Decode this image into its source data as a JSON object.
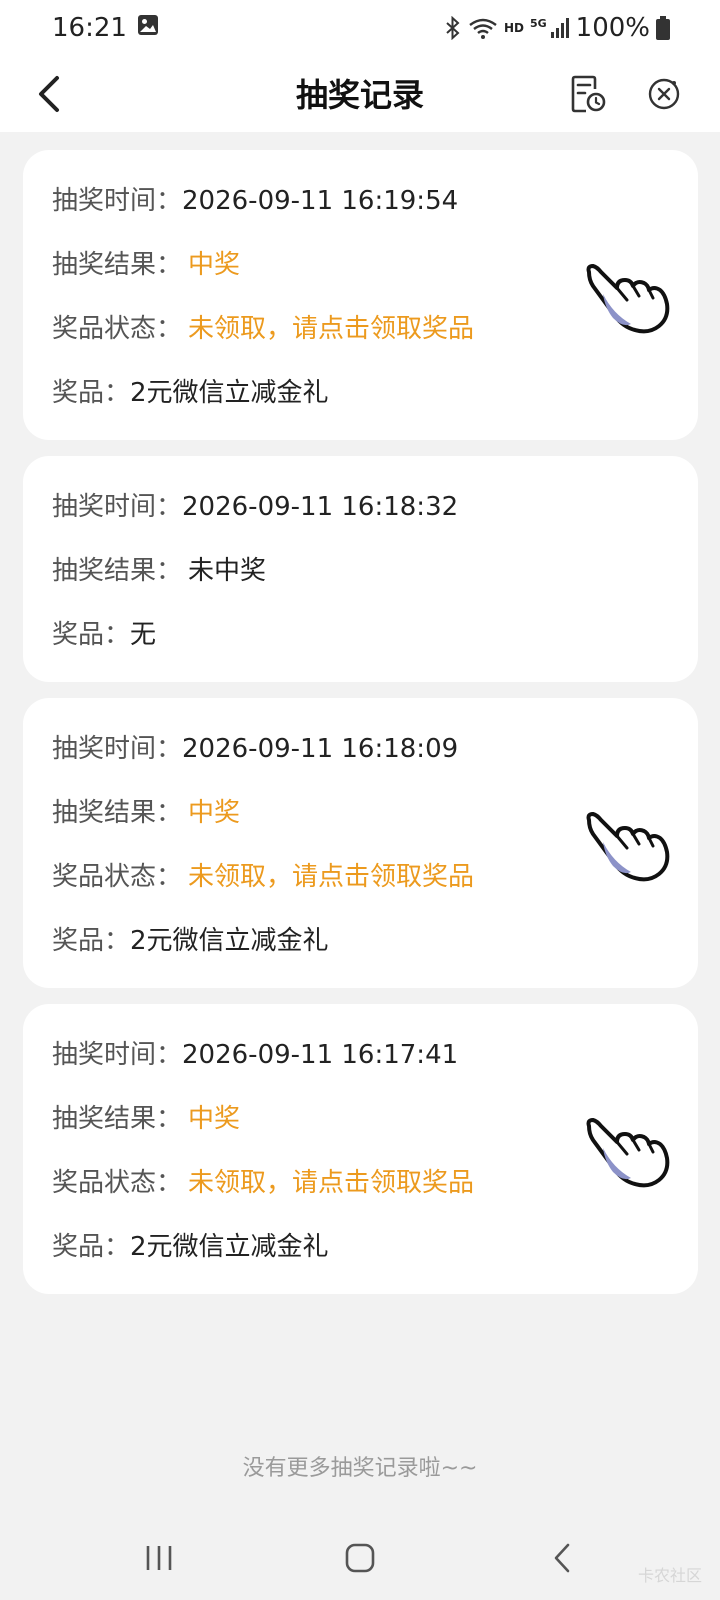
{
  "status_bar": {
    "time": "16:21",
    "network_label": "HD",
    "signal_label": "5G",
    "battery": "100%",
    "icons": [
      "image-icon",
      "bluetooth-icon",
      "wifi-icon",
      "signal-icon",
      "battery-icon"
    ]
  },
  "header": {
    "title": "抽奖记录",
    "icons": [
      "back-icon",
      "history-icon",
      "close-circle-icon"
    ]
  },
  "records": [
    {
      "time_label": "抽奖时间：",
      "time_value": "2026-09-11 16:19:54",
      "result_label": "抽奖结果：",
      "result_value": "中奖",
      "status_label": "奖品状态：",
      "status_value": "未领取，请点击领取奖品",
      "prize_label": "奖品：",
      "prize_value": "2元微信立减金礼",
      "has_claim_hand": true
    },
    {
      "time_label": "抽奖时间：",
      "time_value": "2026-09-11 16:18:32",
      "result_label": "抽奖结果：",
      "result_value": "未中奖",
      "prize_label": "奖品：",
      "prize_value": "无",
      "has_claim_hand": false
    },
    {
      "time_label": "抽奖时间：",
      "time_value": "2026-09-11 16:18:09",
      "result_label": "抽奖结果：",
      "result_value": "中奖",
      "status_label": "奖品状态：",
      "status_value": "未领取，请点击领取奖品",
      "prize_label": "奖品：",
      "prize_value": "2元微信立减金礼",
      "has_claim_hand": true
    },
    {
      "time_label": "抽奖时间：",
      "time_value": "2026-09-11 16:17:41",
      "result_label": "抽奖结果：",
      "result_value": "中奖",
      "status_label": "奖品状态：",
      "status_value": "未领取，请点击领取奖品",
      "prize_label": "奖品：",
      "prize_value": "2元微信立减金礼",
      "has_claim_hand": true
    }
  ],
  "footer_note": "没有更多抽奖记录啦~~",
  "watermark": "卡农社区",
  "colors": {
    "accent_orange": "#ec9a1e",
    "background": "#f2f2f2",
    "card": "#ffffff"
  },
  "navbar": {
    "icons": [
      "recent-apps-icon",
      "home-icon",
      "back-nav-icon"
    ]
  }
}
